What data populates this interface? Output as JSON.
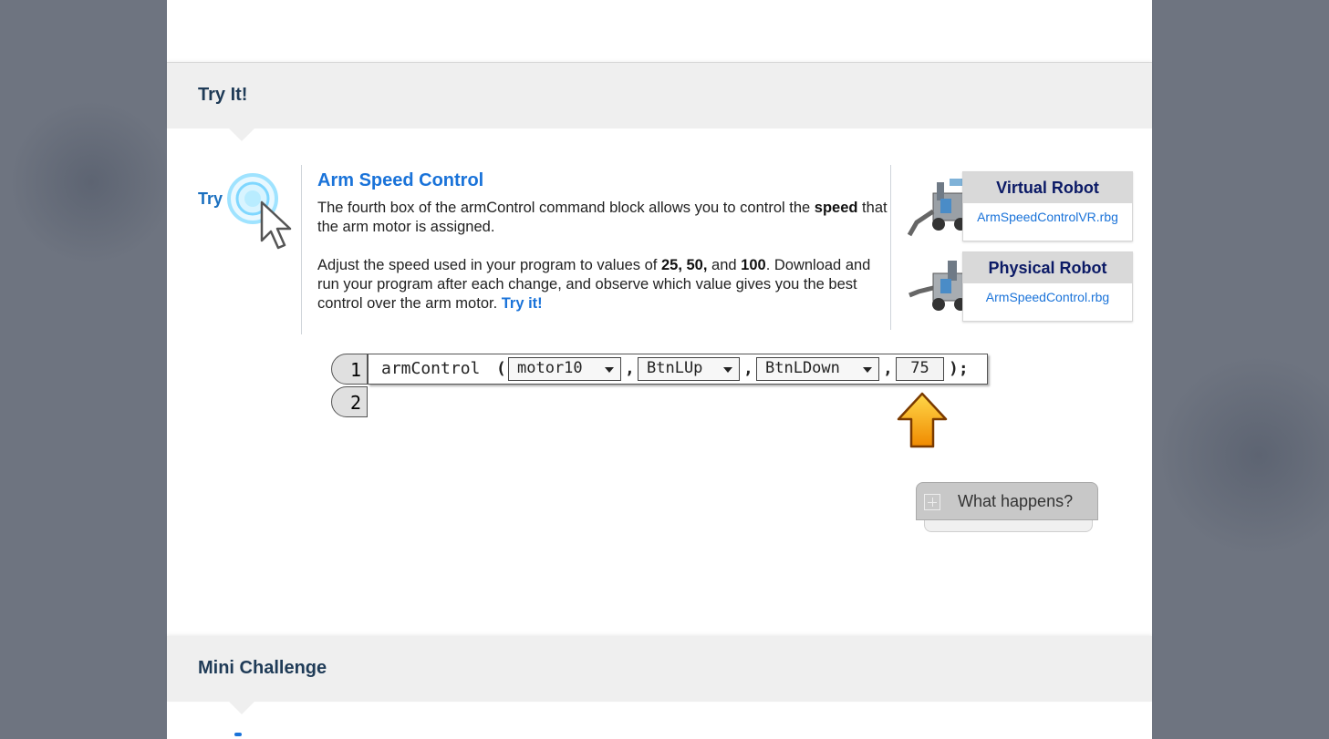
{
  "sections": {
    "try_it_title": "Try It!",
    "mini_challenge_title": "Mini Challenge"
  },
  "try_it": {
    "label": "Try it! 1",
    "heading": "Arm Speed Control",
    "p1_pre": "The fourth box of the armControl command block allows you to control the ",
    "p1_bold": "speed",
    "p1_post": " that the arm motor is assigned.",
    "p2_pre": "Adjust the speed used in your program to values of ",
    "p2_v1": "25, 50,",
    "p2_mid": " and ",
    "p2_v2": "100",
    "p2_post": ". Download and run your program after each change, and observe which value gives you the best control over the arm motor. ",
    "p2_link": "Try it!"
  },
  "robots": [
    {
      "title": "Virtual Robot",
      "file": "ArmSpeedControlVR.rbg"
    },
    {
      "title": "Physical Robot",
      "file": "ArmSpeedControl.rbg"
    }
  ],
  "code": {
    "line1_num": "1",
    "line2_num": "2",
    "func": "armControl",
    "open": "(",
    "comma": ",",
    "close": ");",
    "motor": "motor10",
    "btn_up": "BtnLUp",
    "btn_down": "BtnLDown",
    "speed": "75"
  },
  "what_happens": "What happens?",
  "colors": {
    "accent_blue": "#1a73d9",
    "section_title": "#1f3b57",
    "robot_title": "#0b1a66",
    "arrow": "#f5a000"
  }
}
